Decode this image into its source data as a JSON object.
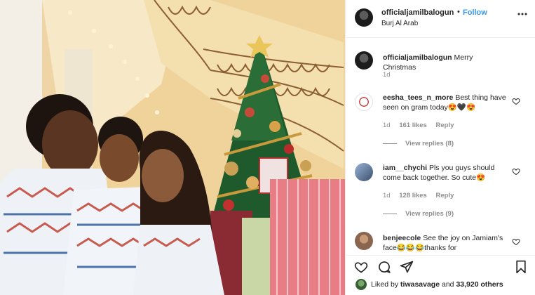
{
  "post": {
    "author": "officialjamilbalogun",
    "follow_label": "Follow",
    "separator": "•",
    "location": "Burj Al Arab",
    "caption_author": "officialjamilbalogun",
    "caption_text": "Merry Christmas",
    "caption_age": "1d"
  },
  "comments": [
    {
      "user": "eesha_tees_n_more",
      "text": "Best thing have seen on gram today😍🖤😍",
      "age": "1d",
      "likes": "161 likes",
      "reply_label": "Reply",
      "view_replies": "View replies (8)"
    },
    {
      "user": "iam__chychi",
      "text": "Pls you guys should come back together. So cute😍",
      "age": "1d",
      "likes": "128 likes",
      "reply_label": "Reply",
      "view_replies": "View replies (9)"
    },
    {
      "user": "benjeecole",
      "text": "See the joy on Jamiam's face😂😂😂thanks for"
    }
  ],
  "likes": {
    "prefix": "Liked by",
    "first_user": "tiwasavage",
    "middle": "and",
    "others": "33,920 others"
  },
  "icons": {
    "more": "more-options-icon",
    "heart": "heart-icon",
    "comment": "comment-icon",
    "share": "share-icon",
    "save": "bookmark-icon"
  },
  "colors": {
    "follow": "#3897f0",
    "muted": "#8e8e8e",
    "text": "#262626"
  }
}
